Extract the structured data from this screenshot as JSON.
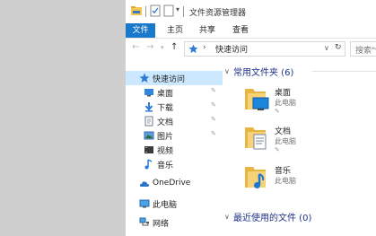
{
  "window": {
    "title": "文件资源管理器"
  },
  "ribbon": {
    "tabs": [
      "文件",
      "主页",
      "共享",
      "查看"
    ]
  },
  "address": {
    "location": "快速访问",
    "search_placeholder": "搜索\"快"
  },
  "nav": {
    "items": [
      {
        "label": "快速访问",
        "icon": "star-icon",
        "pinned": false
      },
      {
        "label": "桌面",
        "icon": "desktop-icon",
        "pinned": true
      },
      {
        "label": "下载",
        "icon": "download-icon",
        "pinned": true
      },
      {
        "label": "文档",
        "icon": "document-icon",
        "pinned": true
      },
      {
        "label": "图片",
        "icon": "picture-icon",
        "pinned": true
      },
      {
        "label": "视频",
        "icon": "video-icon",
        "pinned": false
      },
      {
        "label": "音乐",
        "icon": "music-icon",
        "pinned": false
      },
      {
        "label": "OneDrive",
        "icon": "cloud-icon",
        "pinned": false
      },
      {
        "label": "此电脑",
        "icon": "pc-icon",
        "pinned": false
      },
      {
        "label": "网络",
        "icon": "network-icon",
        "pinned": false
      }
    ]
  },
  "content": {
    "frequent_header": "常用文件夹 (6)",
    "recent_header": "最近使用的文件 (0)",
    "folders": [
      {
        "name": "桌面",
        "location": "此电脑",
        "pinned": true,
        "overlay": "desktop"
      },
      {
        "name": "文档",
        "location": "此电脑",
        "pinned": true,
        "overlay": "document"
      },
      {
        "name": "音乐",
        "location": "此电脑",
        "pinned": false,
        "overlay": "music"
      }
    ]
  },
  "colors": {
    "accent": "#1979ca",
    "folder": "#f3c653",
    "header": "#1e3287",
    "selected": "#cce8ff"
  }
}
